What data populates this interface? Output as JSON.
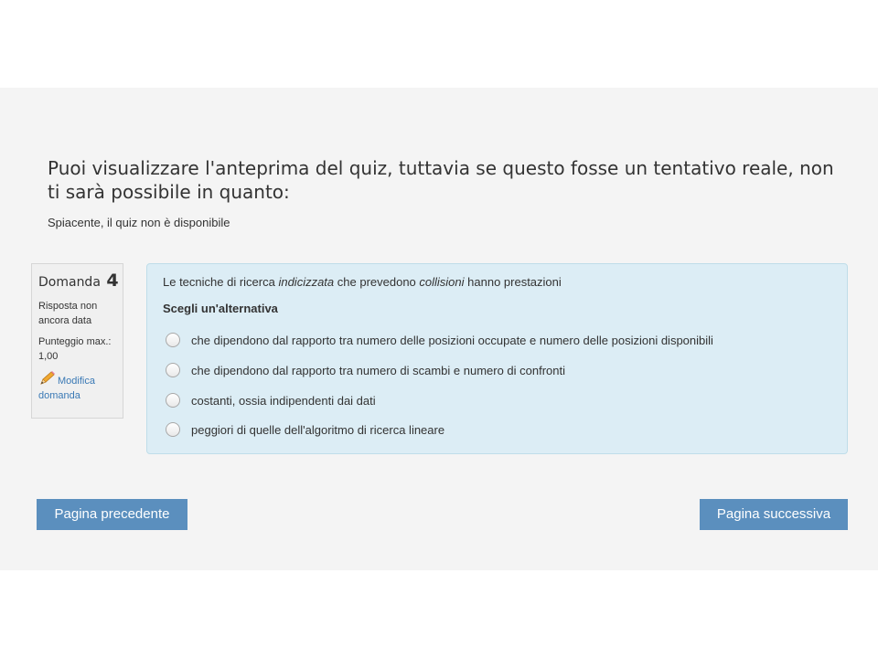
{
  "notice": {
    "heading": "Puoi visualizzare l'anteprima del quiz, tuttavia se questo fosse un tentativo reale, non ti sarà possibile in quanto:",
    "text": "Spiacente, il quiz non è disponibile"
  },
  "question_info": {
    "label": "Domanda",
    "number": "4",
    "state": "Risposta non ancora data",
    "grade": "Punteggio max.: 1,00",
    "edit_link": "Modifica domanda",
    "edit_icon": "pencil-icon"
  },
  "question": {
    "text_part1": "Le tecniche di ricerca ",
    "text_em1": "indicizzata",
    "text_part2": " che prevedono ",
    "text_em2": "collisioni",
    "text_part3": " hanno prestazioni",
    "prompt": "Scegli un'alternativa",
    "answers": [
      {
        "label": "che dipendono dal rapporto tra numero delle posizioni occupate e numero delle posizioni disponibili",
        "selected": false
      },
      {
        "label": "che dipendono dal rapporto tra numero di scambi e numero di confronti",
        "selected": false
      },
      {
        "label": "costanti, ossia indipendenti dai dati",
        "selected": false
      },
      {
        "label": "peggiori di quelle dell'algoritmo di ricerca lineare",
        "selected": false
      }
    ]
  },
  "navigation": {
    "previous": "Pagina precedente",
    "next": "Pagina successiva"
  },
  "colors": {
    "page_band": "#f4f4f4",
    "question_box": "#dcedf5",
    "button": "#5b8fbe",
    "link": "#3a79b5"
  }
}
